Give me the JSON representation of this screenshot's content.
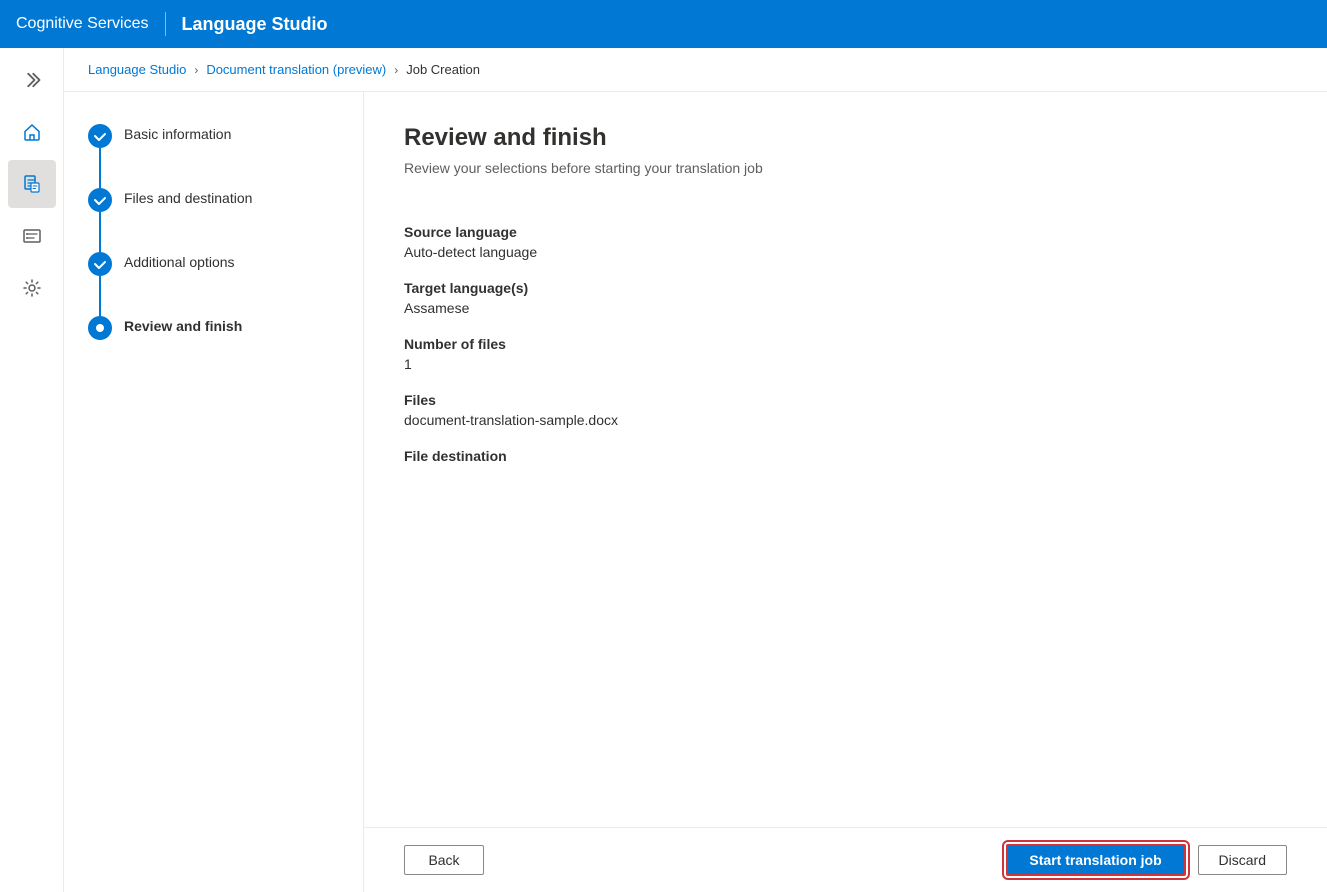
{
  "topbar": {
    "service_label": "Cognitive Services",
    "divider": "|",
    "app_title": "Language Studio"
  },
  "breadcrumb": {
    "link1": "Language Studio",
    "link2": "Document translation (preview)",
    "current": "Job Creation"
  },
  "steps": [
    {
      "id": "basic-information",
      "label": "Basic information",
      "state": "completed"
    },
    {
      "id": "files-and-destination",
      "label": "Files and destination",
      "state": "completed"
    },
    {
      "id": "additional-options",
      "label": "Additional options",
      "state": "completed"
    },
    {
      "id": "review-and-finish",
      "label": "Review and finish",
      "state": "active"
    }
  ],
  "review": {
    "title": "Review and finish",
    "subtitle": "Review your selections before starting your translation job",
    "fields": [
      {
        "label": "Source language",
        "value": "Auto-detect language"
      },
      {
        "label": "Target language(s)",
        "value": "Assamese"
      },
      {
        "label": "Number of files",
        "value": "1"
      },
      {
        "label": "Files",
        "value": "document-translation-sample.docx"
      },
      {
        "label": "File destination",
        "value": ""
      }
    ]
  },
  "actions": {
    "back_label": "Back",
    "start_label": "Start translation job",
    "discard_label": "Discard"
  },
  "sidebar": {
    "chevron_icon": "chevron-right",
    "nav_items": [
      {
        "id": "home",
        "icon": "home-icon"
      },
      {
        "id": "document",
        "icon": "document-icon",
        "active": true
      },
      {
        "id": "list",
        "icon": "list-icon"
      },
      {
        "id": "settings",
        "icon": "settings-icon"
      }
    ]
  }
}
